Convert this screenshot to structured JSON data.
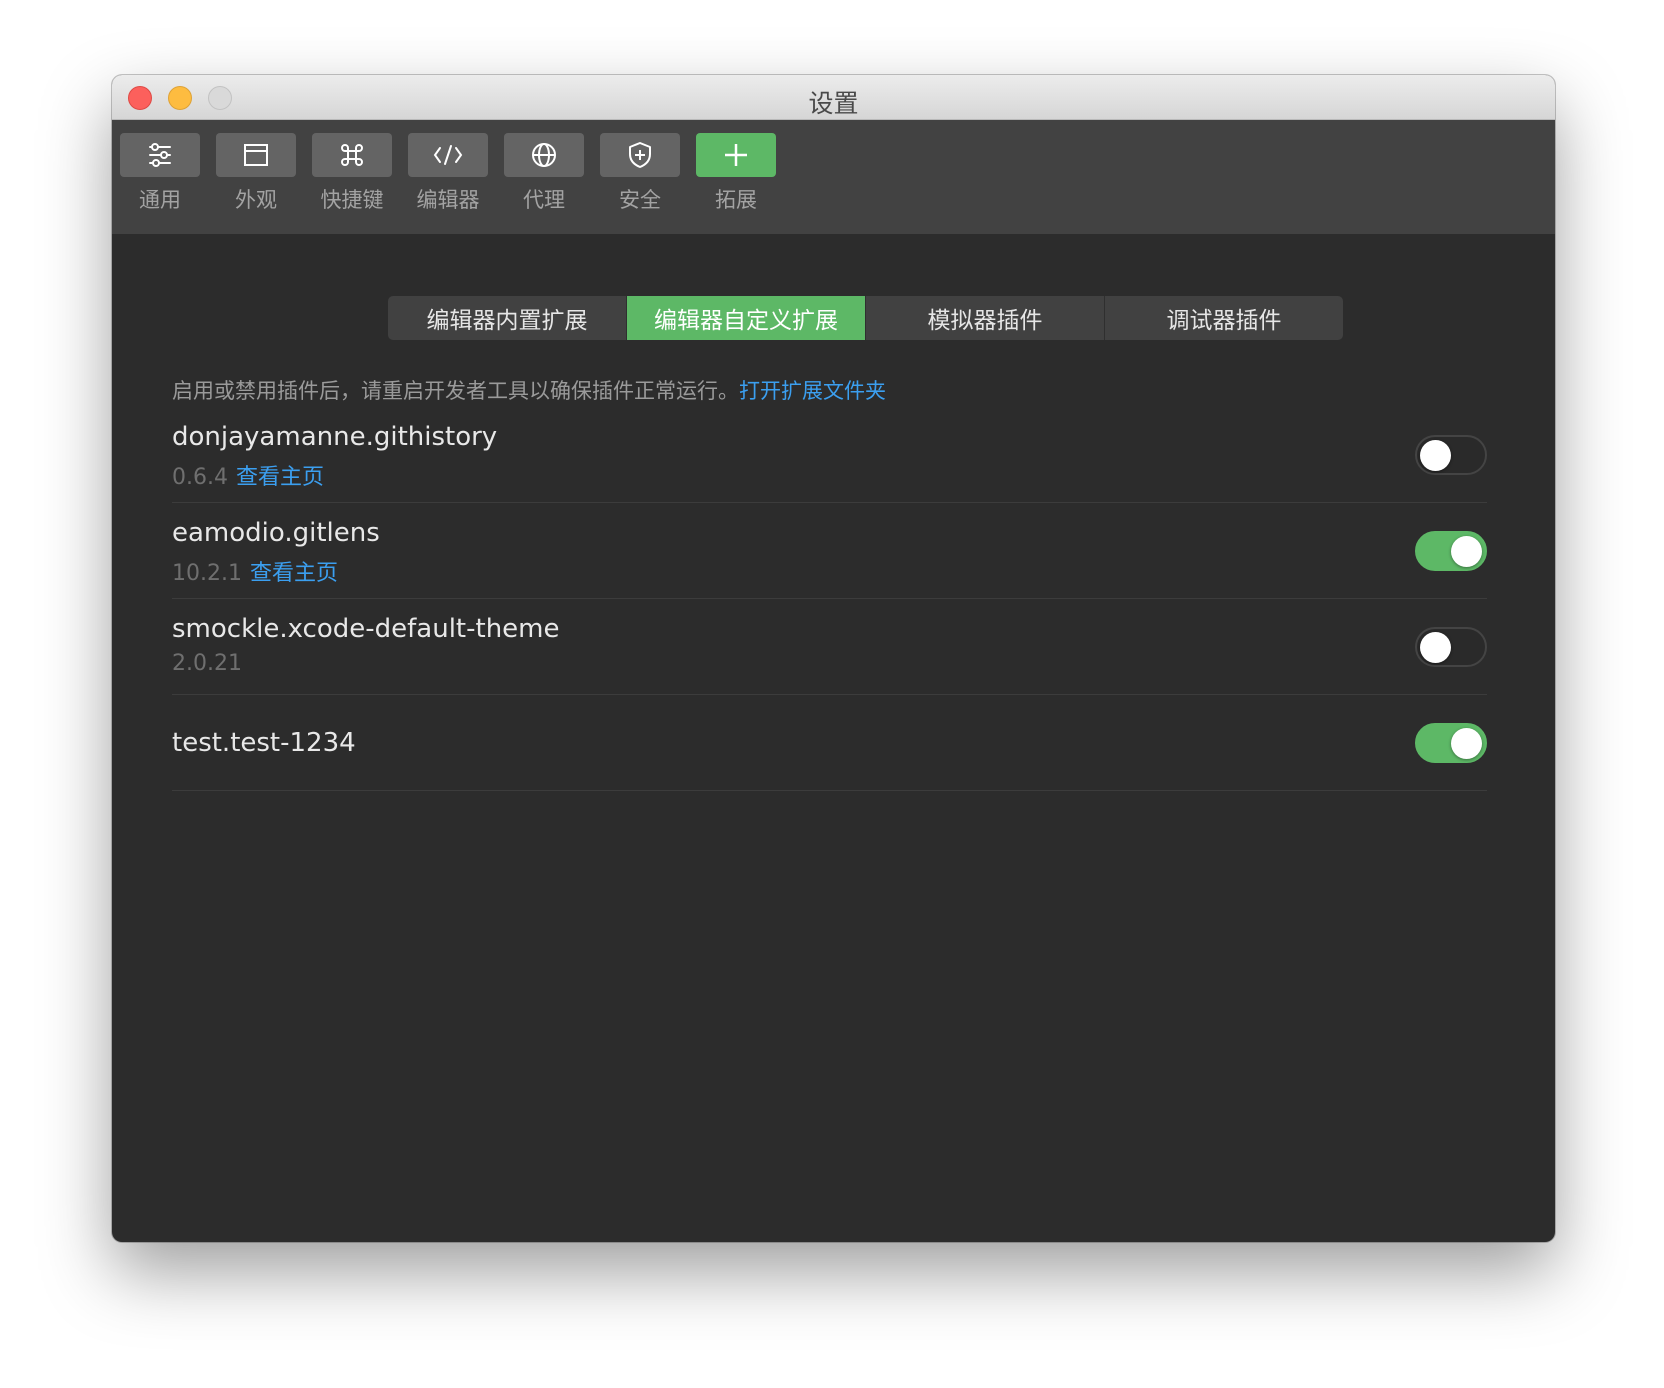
{
  "window": {
    "title": "设置"
  },
  "toolbar": {
    "items": [
      {
        "label": "通用",
        "icon": "sliders-icon"
      },
      {
        "label": "外观",
        "icon": "window-icon"
      },
      {
        "label": "快捷键",
        "icon": "command-icon"
      },
      {
        "label": "编辑器",
        "icon": "code-icon"
      },
      {
        "label": "代理",
        "icon": "globe-icon"
      },
      {
        "label": "安全",
        "icon": "shield-icon"
      },
      {
        "label": "拓展",
        "icon": "plus-icon",
        "active": true
      }
    ]
  },
  "tabs": [
    {
      "label": "编辑器内置扩展"
    },
    {
      "label": "编辑器自定义扩展",
      "active": true
    },
    {
      "label": "模拟器插件"
    },
    {
      "label": "调试器插件"
    }
  ],
  "notice": {
    "text": "启用或禁用插件后，请重启开发者工具以确保插件正常运行。",
    "link": "打开扩展文件夹"
  },
  "extensions": [
    {
      "name": "donjayamanne.githistory",
      "version": "0.6.4",
      "link": "查看主页",
      "enabled": false
    },
    {
      "name": "eamodio.gitlens",
      "version": "10.2.1",
      "link": "查看主页",
      "enabled": true
    },
    {
      "name": "smockle.xcode-default-theme",
      "version": "2.0.21",
      "link": "",
      "enabled": false
    },
    {
      "name": "test.test-1234",
      "version": "",
      "link": "",
      "enabled": true
    }
  ],
  "colors": {
    "accent": "#5db866",
    "link": "#3b9ff0",
    "background": "#2c2c2c",
    "toolbar": "#424242"
  }
}
